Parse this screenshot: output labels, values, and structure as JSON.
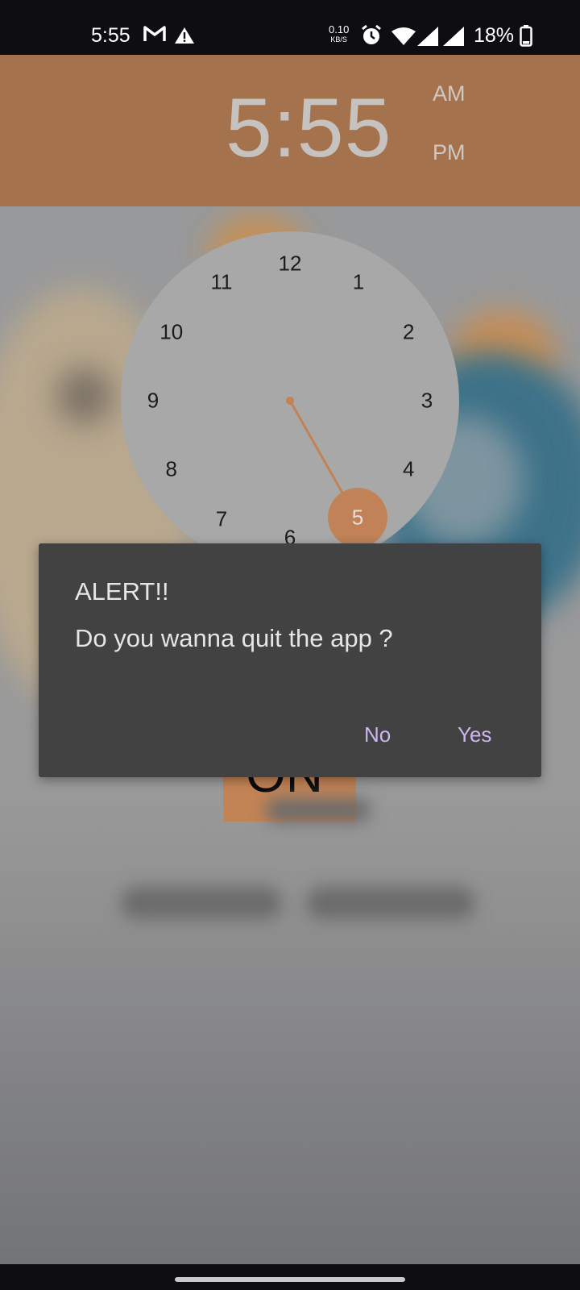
{
  "status_bar": {
    "time": "5:55",
    "net_speed_top": "0.10",
    "net_speed_bottom": "KB/S",
    "battery": "18%",
    "icons": [
      "gmail-icon",
      "warning-icon",
      "alarm-icon",
      "wifi-icon",
      "signal-icon",
      "signal-icon",
      "battery-icon"
    ]
  },
  "header": {
    "time": "5:55",
    "am_label": "AM",
    "pm_label": "PM"
  },
  "clock": {
    "numbers": [
      "12",
      "1",
      "2",
      "3",
      "4",
      "5",
      "6",
      "7",
      "8",
      "9",
      "10",
      "11"
    ],
    "selected": "5",
    "accent_color": "#c08256"
  },
  "main": {
    "on_button_label": "ON"
  },
  "dialog": {
    "title": "ALERT!!",
    "message": "Do you wanna quit the app ?",
    "no_label": "No",
    "yes_label": "Yes"
  },
  "colors": {
    "header_bg": "#a4724d",
    "dialog_bg": "#424242",
    "dialog_button": "#cdb6ef"
  }
}
